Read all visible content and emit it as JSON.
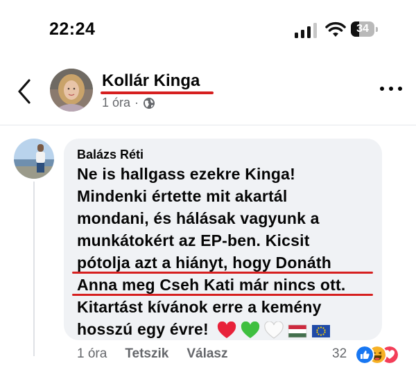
{
  "status_bar": {
    "time": "22:24",
    "battery_level": "34"
  },
  "post": {
    "author_name": "Kollár Kinga",
    "time_ago": "1 óra",
    "separator": "·"
  },
  "comment": {
    "author_name": "Balázs Réti",
    "lines": [
      "Ne is hallgass ezekre Kinga!",
      "Mindenki értette mit akartál",
      "mondani, és hálásak vagyunk a",
      "munkátokért az EP-ben. Kicsit",
      "pótolja azt a hiányt, hogy Donáth",
      "Anna meg Cseh Kati már nincs ott.",
      "Kitartást kívánok erre a kemény",
      "hosszú egy évre!"
    ],
    "emojis": [
      "red-heart",
      "green-heart",
      "white-heart",
      "hungary-flag",
      "eu-flag"
    ],
    "time_ago": "1 óra",
    "like_label": "Tetszik",
    "reply_label": "Válasz",
    "reaction_count": "32",
    "reaction_types": [
      "like",
      "haha",
      "love"
    ]
  },
  "colors": {
    "annotation_red": "#d61f1f",
    "bubble_bg": "#f0f2f5",
    "meta_gray": "#65676b",
    "like_blue": "#1877f2",
    "love_red": "#f33e58"
  }
}
